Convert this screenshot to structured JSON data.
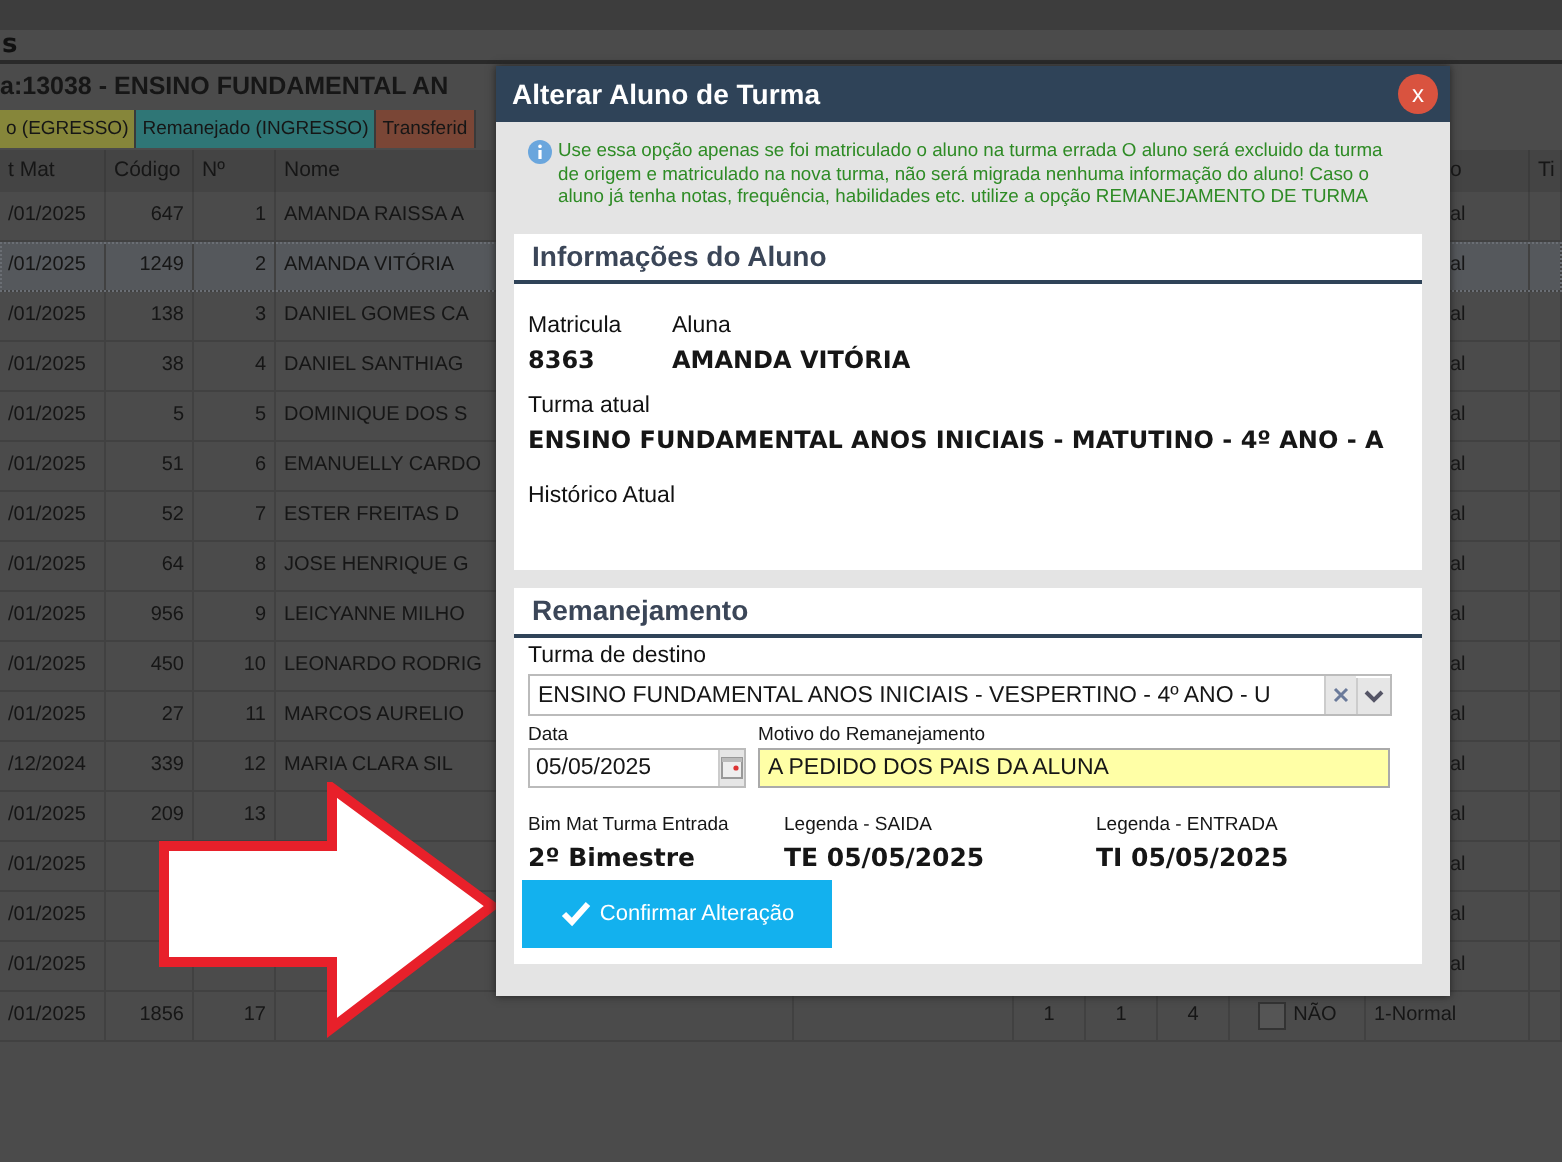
{
  "page": {
    "header_fragment": "s",
    "class_title": "a:13038 - ENSINO FUNDAMENTAL AN"
  },
  "legend": [
    {
      "label": "o (EGRESSO)",
      "color": "#86863a"
    },
    {
      "label": "Remanejado (INGRESSO)",
      "color": "#2f7676"
    },
    {
      "label": "Transferid",
      "color": "#7a4636"
    }
  ],
  "table": {
    "columns": [
      "t Mat",
      "Código",
      "Nº",
      "Nome",
      "o",
      "Ti"
    ],
    "rows": [
      {
        "date": "/01/2025",
        "code": "647",
        "number": "1",
        "name": "AMANDA RAISSA A",
        "status": "al",
        "selected": false
      },
      {
        "date": "/01/2025",
        "code": "1249",
        "number": "2",
        "name": "AMANDA VITÓRIA",
        "status": "al",
        "selected": true
      },
      {
        "date": "/01/2025",
        "code": "138",
        "number": "3",
        "name": "DANIEL GOMES CA",
        "status": "al",
        "selected": false
      },
      {
        "date": "/01/2025",
        "code": "38",
        "number": "4",
        "name": "DANIEL SANTHIAG",
        "status": "al",
        "selected": false
      },
      {
        "date": "/01/2025",
        "code": "5",
        "number": "5",
        "name": "DOMINIQUE DOS S",
        "status": "al",
        "selected": false
      },
      {
        "date": "/01/2025",
        "code": "51",
        "number": "6",
        "name": "EMANUELLY CARDO",
        "status": "al",
        "selected": false
      },
      {
        "date": "/01/2025",
        "code": "52",
        "number": "7",
        "name": "ESTER FREITAS D",
        "status": "al",
        "selected": false
      },
      {
        "date": "/01/2025",
        "code": "64",
        "number": "8",
        "name": "JOSE HENRIQUE G",
        "status": "al",
        "selected": false
      },
      {
        "date": "/01/2025",
        "code": "956",
        "number": "9",
        "name": "LEICYANNE MILHO",
        "status": "al",
        "selected": false
      },
      {
        "date": "/01/2025",
        "code": "450",
        "number": "10",
        "name": "LEONARDO RODRIG",
        "status": "al",
        "selected": false
      },
      {
        "date": "/01/2025",
        "code": "27",
        "number": "11",
        "name": "MARCOS AURELIO",
        "status": "al",
        "selected": false
      },
      {
        "date": "/12/2024",
        "code": "339",
        "number": "12",
        "name": "MARIA CLARA SIL",
        "status": "al",
        "selected": false
      },
      {
        "date": "/01/2025",
        "code": "209",
        "number": "13",
        "status": "al",
        "selected": false
      },
      {
        "date": "/01/2025",
        "status": "al",
        "selected": false
      },
      {
        "date": "/01/2025",
        "status": "al",
        "selected": false
      },
      {
        "date": "/01/2025",
        "status": "al",
        "selected": false
      },
      {
        "date": "/01/2025",
        "code": "1856",
        "number": "17",
        "counts": [
          "1",
          "1",
          "4"
        ],
        "flag": "NÃO",
        "checked": false,
        "status": "1-Normal",
        "selected": false
      }
    ]
  },
  "dialog": {
    "title": "Alterar Aluno de Turma",
    "close_label": "x",
    "notice": "Use essa opção apenas se foi matriculado o aluno na turma errada O aluno será excluido da turma de origem e matriculado na nova turma, não será migrada nenhuma informação do aluno! Caso o aluno já tenha notas, frequência, habilidades etc. utilize a opção REMANEJAMENTO DE TURMA",
    "student_panel": {
      "title": "Informações do Aluno",
      "matricula_label": "Matricula",
      "matricula": "8363",
      "aluna_label": "Aluna",
      "aluna": "AMANDA VITÓRIA",
      "turma_label": "Turma atual",
      "turma": "ENSINO FUNDAMENTAL ANOS INICIAIS - MATUTINO - 4º ANO - A",
      "historico_label": "Histórico Atual"
    },
    "transfer_panel": {
      "title": "Remanejamento",
      "destino_label": "Turma de destino",
      "destino": "ENSINO FUNDAMENTAL ANOS INICIAIS - VESPERTINO - 4º ANO - U",
      "data_label": "Data",
      "data": "05/05/2025",
      "motivo_label": "Motivo do Remanejamento",
      "motivo": "A PEDIDO DOS PAIS DA ALUNA",
      "bim_label": "Bim Mat Turma Entrada",
      "bim": "2º Bimestre",
      "saida_label": "Legenda - SAIDA",
      "saida": "TE 05/05/2025",
      "entrada_label": "Legenda - ENTRADA",
      "entrada": "TI 05/05/2025"
    },
    "confirm_button": "Confirmar Alteração"
  }
}
